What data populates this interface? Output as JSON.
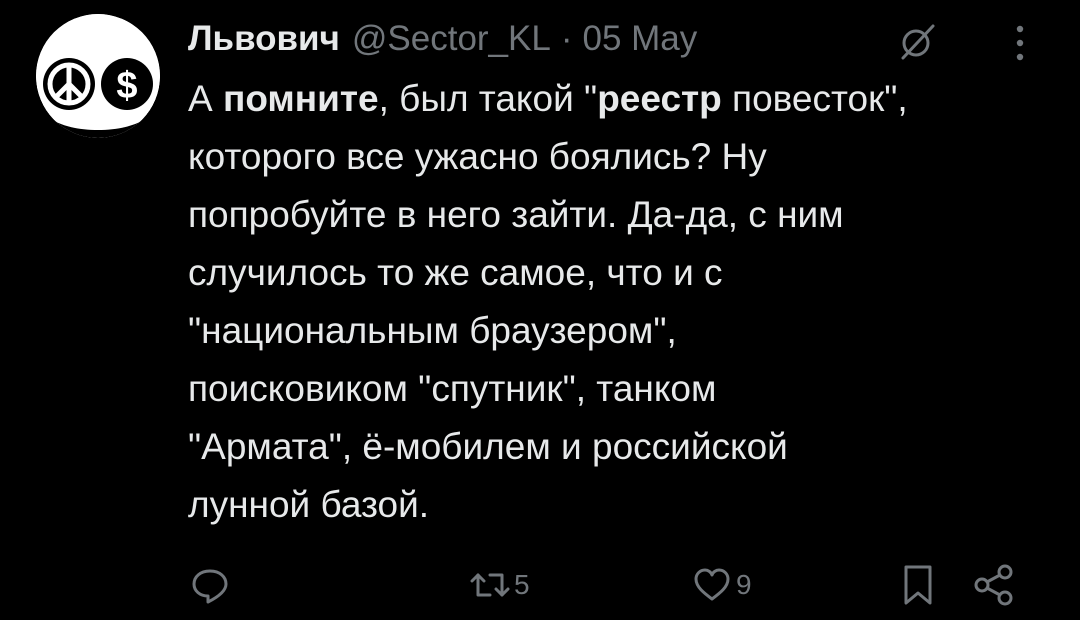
{
  "tweet": {
    "author_name": "Львович",
    "handle": "@Sector_KL",
    "separator": "·",
    "date": "05 May",
    "body": {
      "line1_pre": "А ",
      "line1_bold1": "помните",
      "line1_mid": ", был такой \"",
      "line1_bold2": "реестр",
      "line1_post": " повесток\",",
      "line2": "которого все ужасно боялись? Ну",
      "line3": "попробуйте в него зайти. Да-да, с ним",
      "line4": "случилось то же самое, что и с",
      "line5": "\"национальным браузером\",",
      "line6": "поисковиком \"спутник\", танком",
      "line7": "\"Армата\", ё-мобилем и российской",
      "line8": "лунной базой."
    },
    "stats": {
      "retweets": "5",
      "likes": "9"
    }
  },
  "avatar": {
    "left_symbol": "☮",
    "right_symbol": "$"
  },
  "icons": {
    "hide": "eye-slash-icon",
    "more": "more-vertical-icon",
    "reply": "reply-icon",
    "retweet": "retweet-icon",
    "like": "heart-icon",
    "bookmark": "bookmark-icon",
    "share": "share-icon"
  },
  "colors": {
    "background": "#000000",
    "text": "#e7e9ea",
    "muted": "#71767b"
  }
}
